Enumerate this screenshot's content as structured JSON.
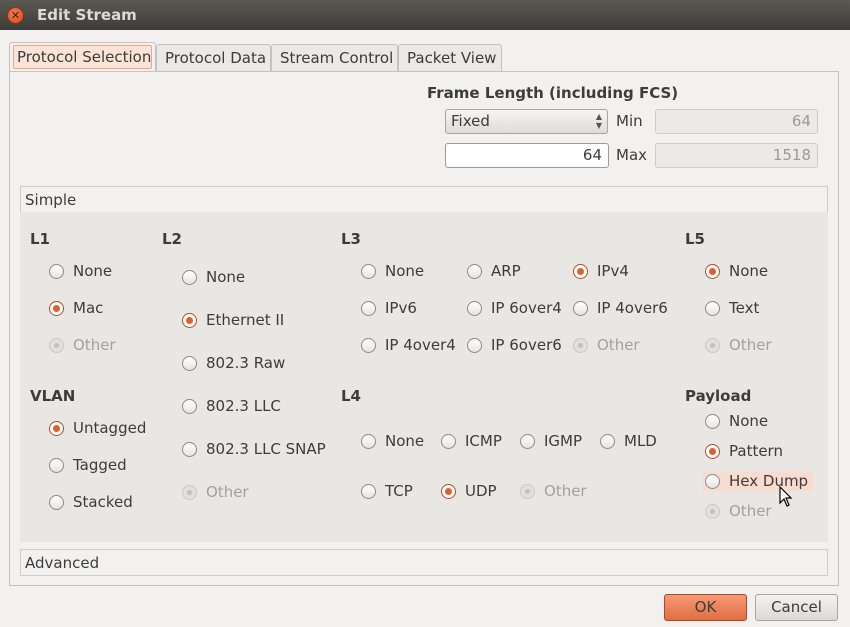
{
  "window": {
    "title": "Edit Stream",
    "close_symbol": "✕"
  },
  "tabs": [
    "Protocol Selection",
    "Protocol Data",
    "Stream Control",
    "Packet View"
  ],
  "frame_length": {
    "label": "Frame Length (including FCS)",
    "mode": "Fixed",
    "value": "64",
    "min_label": "Min",
    "min_value": "64",
    "max_label": "Max",
    "max_value": "1518"
  },
  "sections": {
    "simple": "Simple",
    "advanced": "Advanced"
  },
  "l1": {
    "title": "L1",
    "options": [
      "None",
      "Mac",
      "Other"
    ]
  },
  "vlan": {
    "title": "VLAN",
    "options": [
      "Untagged",
      "Tagged",
      "Stacked"
    ]
  },
  "l2": {
    "title": "L2",
    "options": [
      "None",
      "Ethernet II",
      "802.3 Raw",
      "802.3 LLC",
      "802.3 LLC SNAP",
      "Other"
    ]
  },
  "l3": {
    "title": "L3",
    "options": [
      "None",
      "ARP",
      "IPv4",
      "IPv6",
      "IP 6over4",
      "IP 4over6",
      "IP 4over4",
      "IP 6over6",
      "Other"
    ]
  },
  "l4": {
    "title": "L4",
    "options": [
      "None",
      "ICMP",
      "IGMP",
      "MLD",
      "TCP",
      "UDP",
      "Other"
    ]
  },
  "l5": {
    "title": "L5",
    "options": [
      "None",
      "Text",
      "Other"
    ]
  },
  "payload": {
    "title": "Payload",
    "options": [
      "None",
      "Pattern",
      "Hex Dump",
      "Other"
    ]
  },
  "buttons": {
    "ok": "OK",
    "cancel": "Cancel"
  },
  "colors": {
    "accent": "#e05d2d",
    "titlebar": "#3d3c38",
    "background": "#f2f1f0"
  }
}
